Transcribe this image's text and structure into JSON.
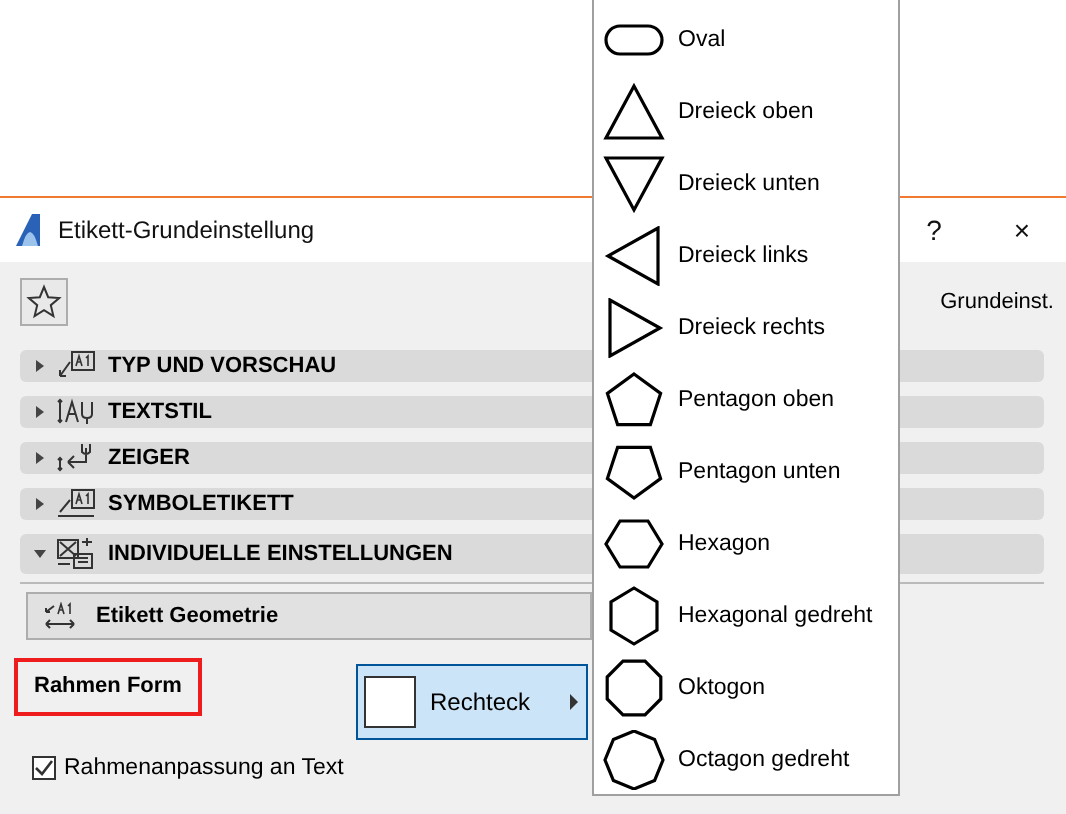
{
  "dialog": {
    "title": "Etikett-Grundeinstellung",
    "help": "?",
    "close": "×",
    "favorite_label": "Grundeinst."
  },
  "sections": [
    {
      "kind": "preview",
      "label": "TYP UND VORSCHAU",
      "expanded": false
    },
    {
      "kind": "textstyle",
      "label": "TEXTSTIL",
      "expanded": false
    },
    {
      "kind": "pointer",
      "label": "ZEIGER",
      "expanded": false
    },
    {
      "kind": "symbol",
      "label": "SYMBOLETIKETT",
      "expanded": false
    },
    {
      "kind": "custom",
      "label": "INDIVIDUELLE EINSTELLUNGEN",
      "expanded": true
    }
  ],
  "subpanel": {
    "label": "Etikett Geometrie"
  },
  "frame_form": {
    "label": "Rahmen Form",
    "value": "Rechteck"
  },
  "fit_frame": {
    "label": "Rahmenanpassung an Text",
    "checked": true
  },
  "shape_menu": [
    {
      "kind": "oval",
      "label": "Oval"
    },
    {
      "kind": "triangle-up",
      "label": "Dreieck oben"
    },
    {
      "kind": "triangle-down",
      "label": "Dreieck unten"
    },
    {
      "kind": "triangle-left",
      "label": "Dreieck links"
    },
    {
      "kind": "triangle-right",
      "label": "Dreieck rechts"
    },
    {
      "kind": "pentagon-up",
      "label": "Pentagon oben"
    },
    {
      "kind": "pentagon-down",
      "label": "Pentagon unten"
    },
    {
      "kind": "hexagon",
      "label": "Hexagon"
    },
    {
      "kind": "hexagon-rotated",
      "label": "Hexagonal gedreht"
    },
    {
      "kind": "octagon",
      "label": "Oktogon"
    },
    {
      "kind": "octagon-rotated",
      "label": "Octagon gedreht"
    }
  ]
}
